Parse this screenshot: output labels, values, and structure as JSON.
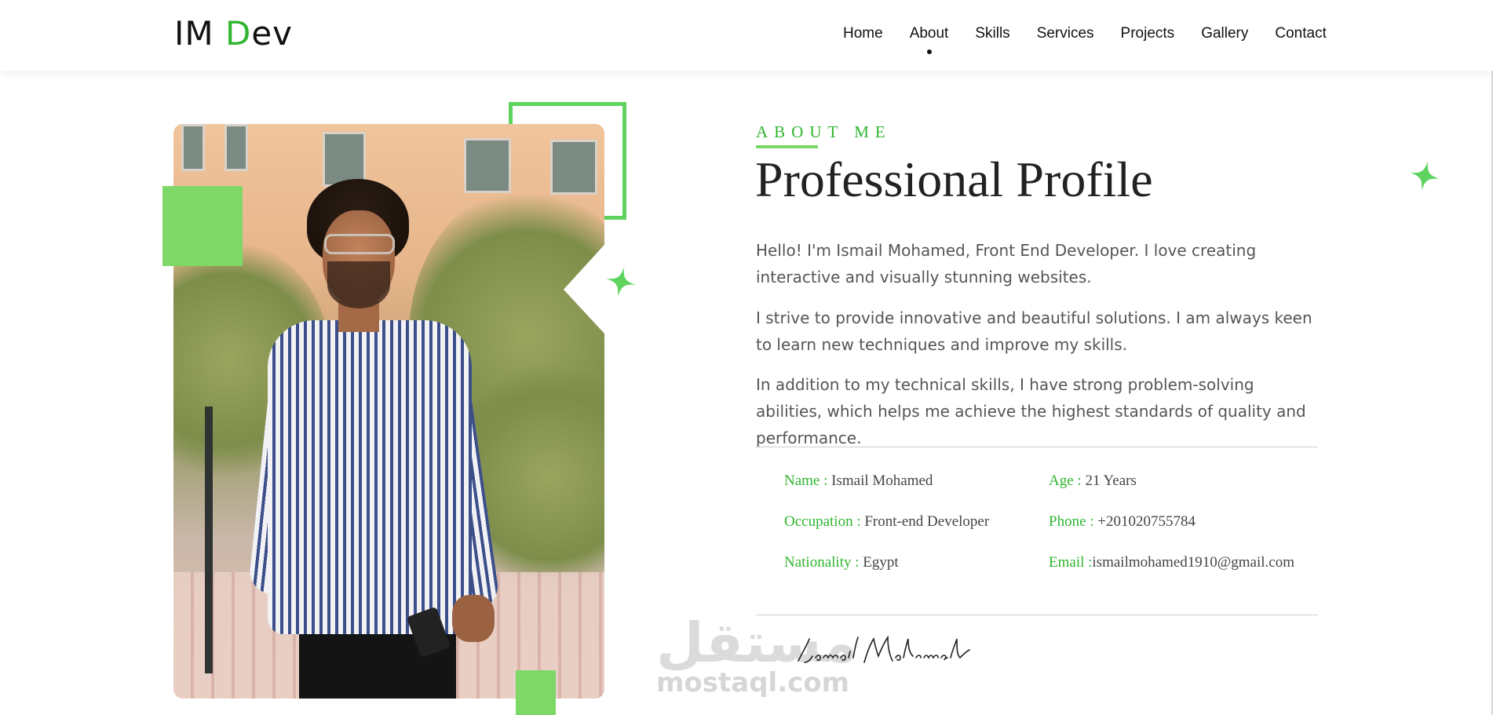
{
  "header": {
    "logo_prefix": "IM ",
    "logo_accent": "D",
    "logo_suffix": "ev",
    "nav": [
      "Home",
      "About",
      "Skills",
      "Services",
      "Projects",
      "Gallery",
      "Contact"
    ],
    "active_nav": "About"
  },
  "about": {
    "eyebrow": "ABOUT ME",
    "title": "Professional Profile",
    "paragraphs": [
      "Hello! I'm Ismail Mohamed, Front End Developer. I love creating interactive and visually stunning websites.",
      "I strive to provide innovative and beautiful solutions. I am always keen to learn new techniques and improve my skills.",
      "In addition to my technical skills, I have strong problem-solving abilities, which helps me achieve the highest standards of quality and performance."
    ],
    "info": {
      "name_key": "Name :",
      "name_val": " Ismail Mohamed",
      "age_key": "Age :",
      "age_val": " 21 Years",
      "occupation_key": "Occupation :",
      "occupation_val": " Front-end Developer",
      "phone_key": "Phone :",
      "phone_val": " +201020755784",
      "nationality_key": "Nationality :",
      "nationality_val": " Egypt",
      "email_key": "Email :",
      "email_val": "ismailmohamed1910@gmail.com"
    },
    "signature": "Ismail Mohamed"
  },
  "watermark": {
    "arabic": "مستقل",
    "latin": "mostaql.com"
  },
  "colors": {
    "accent": "#2fb52f",
    "accent_light": "#7ed867"
  }
}
